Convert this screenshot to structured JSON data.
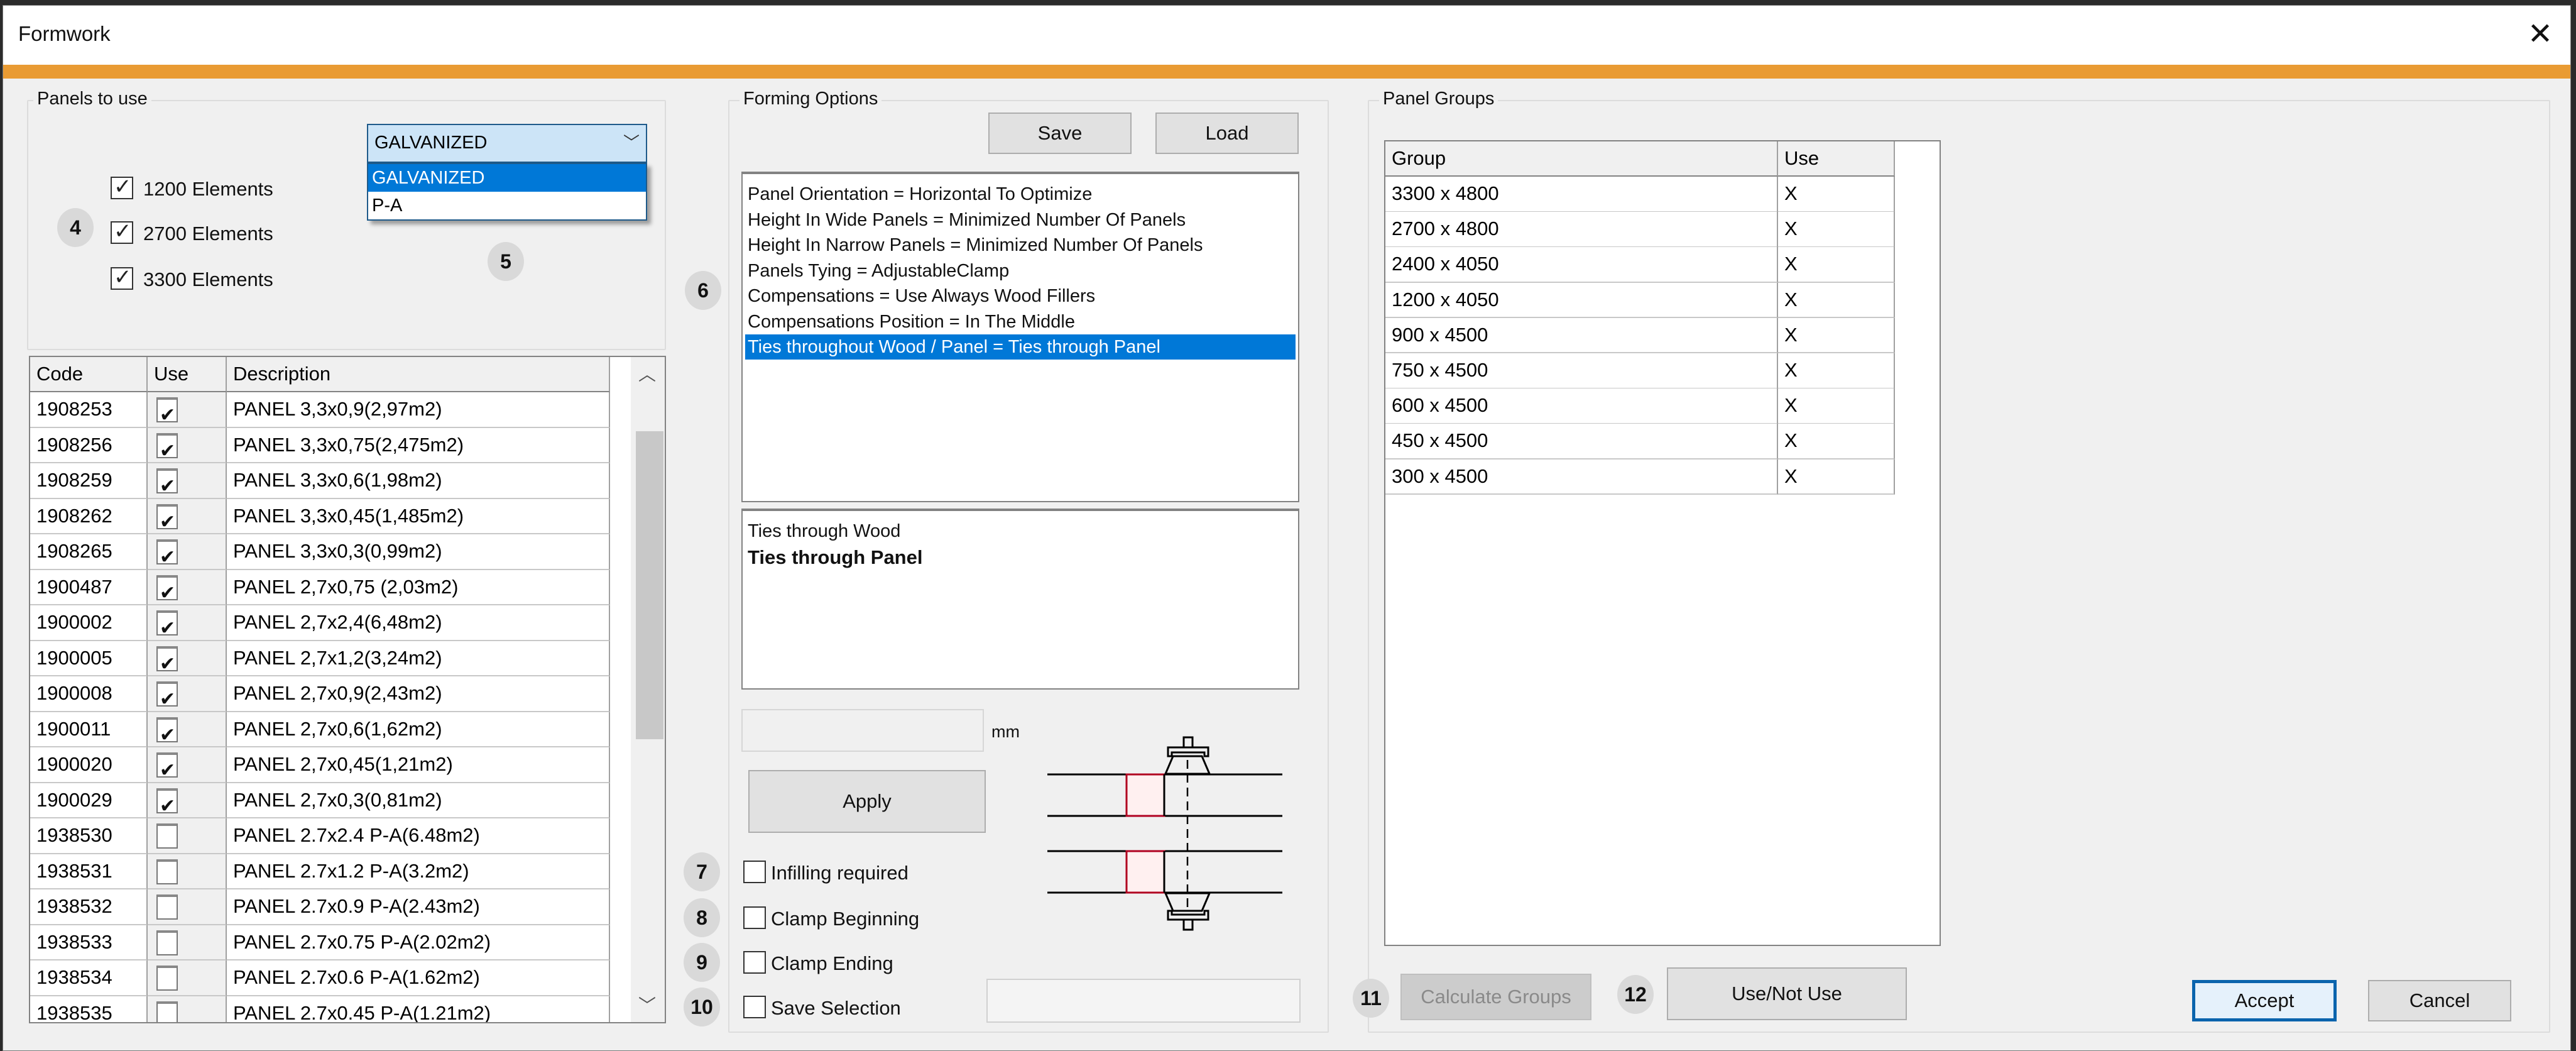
{
  "window": {
    "title": "Formwork",
    "close_icon": "close-icon",
    "accent_color": "#e99b33"
  },
  "panels_to_use": {
    "label": "Panels to use",
    "material_combo": {
      "selected": "GALVANIZED",
      "options": [
        "GALVANIZED",
        "P-A"
      ],
      "highlighted": "GALVANIZED",
      "expanded": true
    },
    "element_checks": [
      {
        "label": "1200 Elements",
        "checked": true
      },
      {
        "label": "2700 Elements",
        "checked": true
      },
      {
        "label": "3300 Elements",
        "checked": true
      }
    ],
    "markers": {
      "checks": "4",
      "combo": "5"
    },
    "table": {
      "columns": [
        "Code",
        "Use",
        "Description"
      ],
      "rows": [
        {
          "code": "1908253",
          "use": true,
          "description": "PANEL 3,3x0,9(2,97m2)"
        },
        {
          "code": "1908256",
          "use": true,
          "description": "PANEL 3,3x0,75(2,475m2)"
        },
        {
          "code": "1908259",
          "use": true,
          "description": "PANEL 3,3x0,6(1,98m2)"
        },
        {
          "code": "1908262",
          "use": true,
          "description": "PANEL 3,3x0,45(1,485m2)"
        },
        {
          "code": "1908265",
          "use": true,
          "description": "PANEL 3,3x0,3(0,99m2)"
        },
        {
          "code": "1900487",
          "use": true,
          "description": "PANEL 2,7x0,75 (2,03m2)"
        },
        {
          "code": "1900002",
          "use": true,
          "description": "PANEL 2,7x2,4(6,48m2)"
        },
        {
          "code": "1900005",
          "use": true,
          "description": "PANEL 2,7x1,2(3,24m2)"
        },
        {
          "code": "1900008",
          "use": true,
          "description": "PANEL 2,7x0,9(2,43m2)"
        },
        {
          "code": "1900011",
          "use": true,
          "description": "PANEL 2,7x0,6(1,62m2)"
        },
        {
          "code": "1900020",
          "use": true,
          "description": "PANEL 2,7x0,45(1,21m2)"
        },
        {
          "code": "1900029",
          "use": true,
          "description": "PANEL 2,7x0,3(0,81m2)"
        },
        {
          "code": "1938530",
          "use": false,
          "description": "PANEL 2.7x2.4 P-A(6.48m2)"
        },
        {
          "code": "1938531",
          "use": false,
          "description": "PANEL 2.7x1.2 P-A(3.2m2)"
        },
        {
          "code": "1938532",
          "use": false,
          "description": "PANEL 2.7x0.9 P-A(2.43m2)"
        },
        {
          "code": "1938533",
          "use": false,
          "description": "PANEL 2.7x0.75 P-A(2.02m2)"
        },
        {
          "code": "1938534",
          "use": false,
          "description": "PANEL 2.7x0.6 P-A(1.62m2)"
        },
        {
          "code": "1938535",
          "use": false,
          "description": "PANEL 2.7x0.45 P-A(1.21m2)"
        }
      ],
      "scroll": {
        "up_icon": "chevron-up-icon",
        "down_icon": "chevron-down-icon"
      }
    }
  },
  "forming_options": {
    "label": "Forming Options",
    "save_label": "Save",
    "load_label": "Load",
    "marker": "6",
    "options": [
      "Panel Orientation = Horizontal To Optimize",
      "Height In Wide Panels = Minimized Number Of Panels",
      "Height In Narrow Panels = Minimized Number Of Panels",
      "Panels Tying = AdjustableClamp",
      "Compensations = Use Always Wood Fillers",
      "Compensations Position = In The Middle",
      "Ties throughout Wood / Panel = Ties through Panel"
    ],
    "selected_option_index": 6,
    "values": [
      {
        "label": "Ties through Wood",
        "selected": false
      },
      {
        "label": "Ties through Panel",
        "selected": true
      }
    ],
    "mm_value": "",
    "mm_unit": "mm",
    "apply_label": "Apply",
    "checks": [
      {
        "marker": "7",
        "label": "Infilling required",
        "checked": false
      },
      {
        "marker": "8",
        "label": "Clamp Beginning",
        "checked": false
      },
      {
        "marker": "9",
        "label": "Clamp Ending",
        "checked": false
      },
      {
        "marker": "10",
        "label": "Save Selection",
        "checked": false
      }
    ],
    "save_selection_value": "",
    "diagram_icon": "clamp-tie-diagram"
  },
  "panel_groups": {
    "label": "Panel Groups",
    "columns": [
      "Group",
      "Use"
    ],
    "rows": [
      {
        "group": "3300 x 4800",
        "use": "X"
      },
      {
        "group": "2700 x 4800",
        "use": "X"
      },
      {
        "group": "2400 x 4050",
        "use": "X"
      },
      {
        "group": "1200 x 4050",
        "use": "X"
      },
      {
        "group": "900 x 4500",
        "use": "X"
      },
      {
        "group": "750 x 4500",
        "use": "X"
      },
      {
        "group": "600 x 4500",
        "use": "X"
      },
      {
        "group": "450 x 4500",
        "use": "X"
      },
      {
        "group": "300 x 4500",
        "use": "X"
      }
    ],
    "calculate_label": "Calculate Groups",
    "calculate_marker": "11",
    "use_not_use_label": "Use/Not Use",
    "use_not_use_marker": "12"
  },
  "footer": {
    "accept_label": "Accept",
    "cancel_label": "Cancel"
  }
}
